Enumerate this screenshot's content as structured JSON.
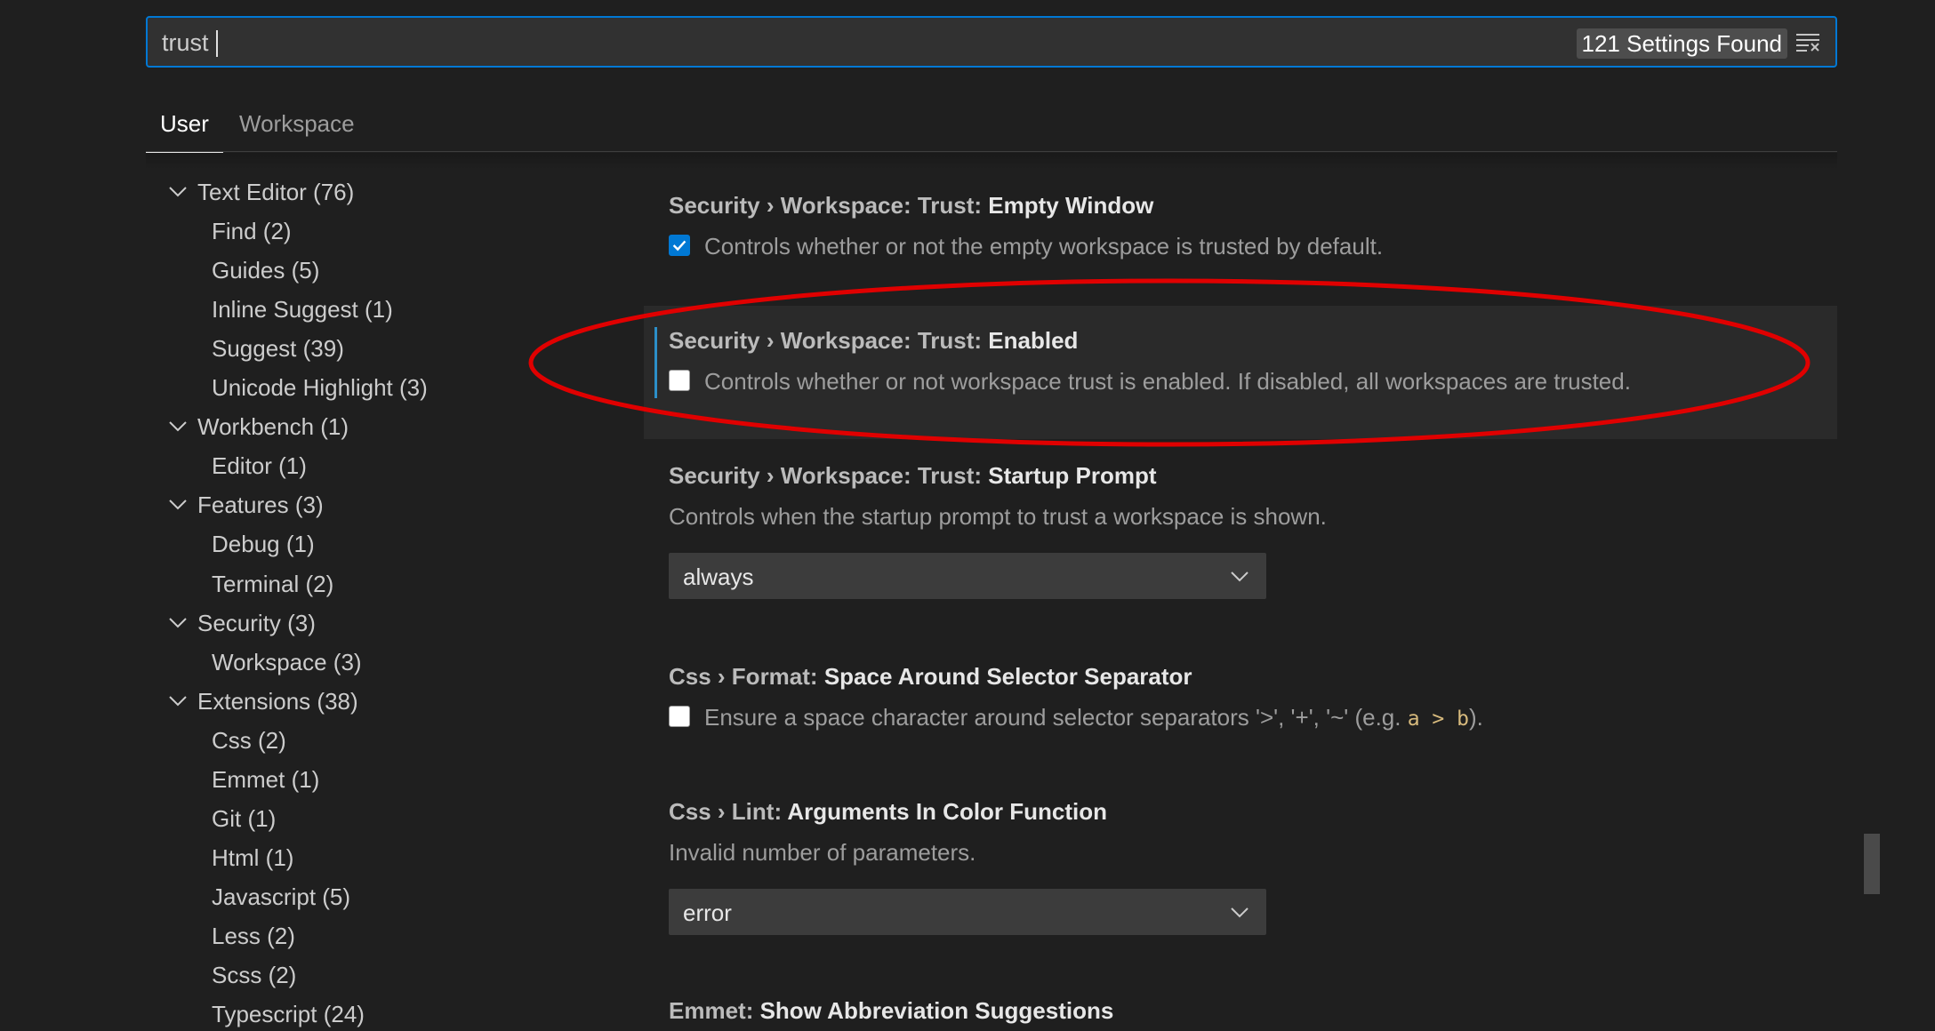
{
  "search": {
    "value": "trust",
    "results": "121 Settings Found",
    "clear_icon": "clear-filter-icon"
  },
  "tabs": [
    {
      "label": "User",
      "active": true
    },
    {
      "label": "Workspace",
      "active": false
    }
  ],
  "toc": [
    {
      "label": "Text Editor (76)",
      "level": 0,
      "expanded": true
    },
    {
      "label": "Find (2)",
      "level": 1
    },
    {
      "label": "Guides (5)",
      "level": 1
    },
    {
      "label": "Inline Suggest (1)",
      "level": 1
    },
    {
      "label": "Suggest (39)",
      "level": 1
    },
    {
      "label": "Unicode Highlight (3)",
      "level": 1
    },
    {
      "label": "Workbench (1)",
      "level": 0,
      "expanded": true
    },
    {
      "label": "Editor (1)",
      "level": 1
    },
    {
      "label": "Features (3)",
      "level": 0,
      "expanded": true
    },
    {
      "label": "Debug (1)",
      "level": 1
    },
    {
      "label": "Terminal (2)",
      "level": 1
    },
    {
      "label": "Security (3)",
      "level": 0,
      "expanded": true
    },
    {
      "label": "Workspace (3)",
      "level": 1
    },
    {
      "label": "Extensions (38)",
      "level": 0,
      "expanded": true
    },
    {
      "label": "Css (2)",
      "level": 1
    },
    {
      "label": "Emmet (1)",
      "level": 1
    },
    {
      "label": "Git (1)",
      "level": 1
    },
    {
      "label": "Html (1)",
      "level": 1
    },
    {
      "label": "Javascript (5)",
      "level": 1
    },
    {
      "label": "Less (2)",
      "level": 1
    },
    {
      "label": "Scss (2)",
      "level": 1
    },
    {
      "label": "Typescript (24)",
      "level": 1
    }
  ],
  "settings": {
    "empty_window": {
      "category": "Security › Workspace: Trust: ",
      "name": "Empty Window",
      "description": "Controls whether or not the empty workspace is trusted by default.",
      "checked": true
    },
    "enabled": {
      "category": "Security › Workspace: Trust: ",
      "name": "Enabled",
      "description": "Controls whether or not workspace trust is enabled. If disabled, all workspaces are trusted.",
      "checked": false
    },
    "startup_prompt": {
      "category": "Security › Workspace: Trust: ",
      "name": "Startup Prompt",
      "description": "Controls when the startup prompt to trust a workspace is shown.",
      "value": "always"
    },
    "space_around_selector": {
      "category": "Css › Format: ",
      "name": "Space Around Selector Separator",
      "description_pre": "Ensure a space character around selector separators '>', '+', '~' (e.g. ",
      "description_code": "a > b",
      "description_post": ").",
      "checked": false
    },
    "arguments_in_color": {
      "category": "Css › Lint: ",
      "name": "Arguments In Color Function",
      "description": "Invalid number of parameters.",
      "value": "error"
    },
    "emmet_abbrev": {
      "category": "Emmet: ",
      "name": "Show Abbreviation Suggestions"
    }
  },
  "colors": {
    "accent": "#0078d4",
    "annotation": "#e00000",
    "background": "#1f1f1f"
  }
}
